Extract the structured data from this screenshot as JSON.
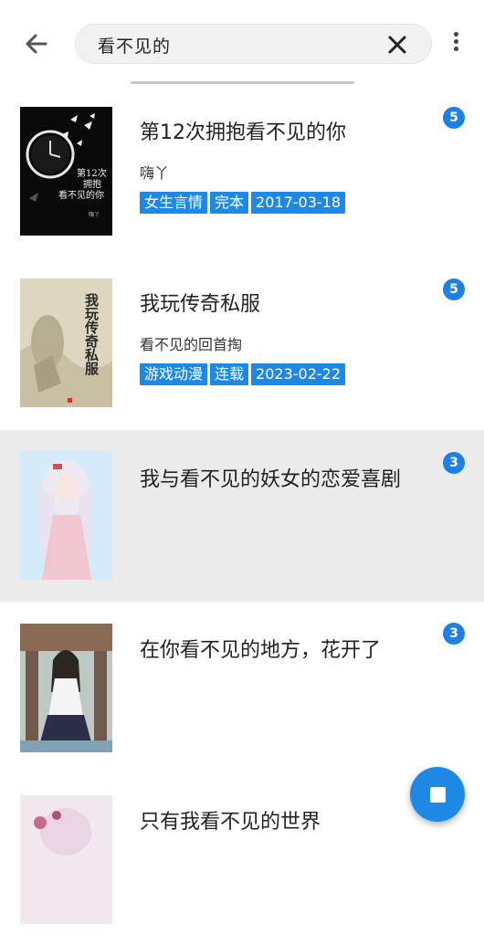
{
  "search": {
    "query": "看不见的"
  },
  "books": [
    {
      "title": "第12次拥抱看不见的你",
      "author": "嗨丫",
      "tags": [
        "女生言情",
        "完本",
        "2017-03-18"
      ],
      "count": "5",
      "cover_text": [
        "第12次",
        "拥抱",
        "看不见的你",
        "嗨丫"
      ]
    },
    {
      "title": "我玩传奇私服",
      "author": "看不见的回首掏",
      "tags": [
        "游戏动漫",
        "连载",
        "2023-02-22"
      ],
      "count": "5",
      "cover_text": [
        "我玩传奇私服"
      ]
    },
    {
      "title": "我与看不见的妖女的恋爱喜剧",
      "author": "",
      "tags": [],
      "count": "3"
    },
    {
      "title": "在你看不见的地方，花开了",
      "author": "",
      "tags": [],
      "count": "3"
    },
    {
      "title": "只有我看不见的世界",
      "author": "",
      "tags": [],
      "count": ""
    }
  ],
  "colors": {
    "accent": "#1e88e5",
    "selected_row": "#ebebeb"
  }
}
